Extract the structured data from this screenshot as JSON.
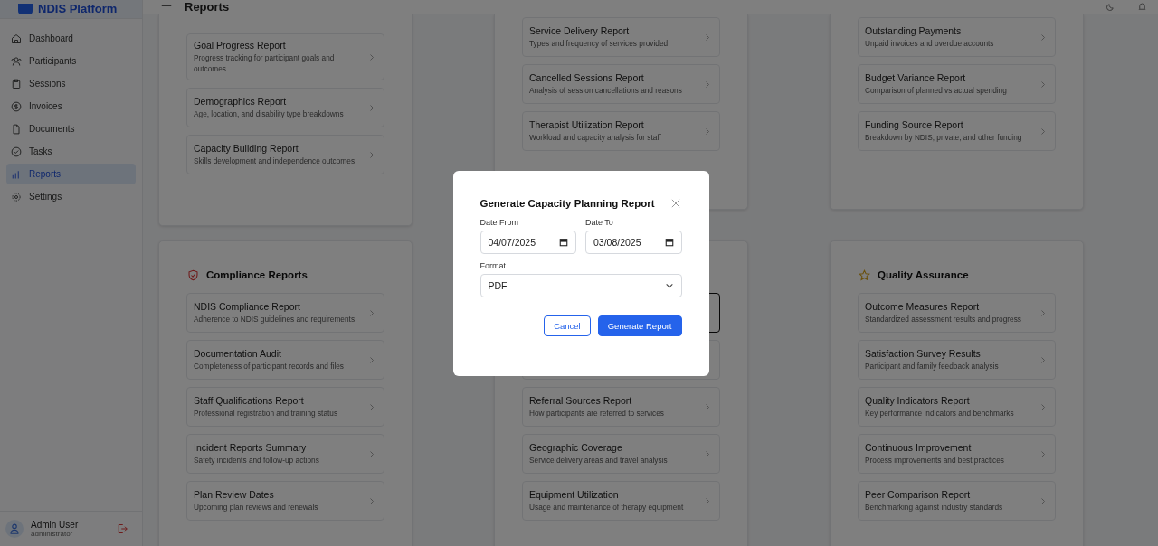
{
  "app": {
    "logo": "NDIS Platform",
    "page_title": "Reports"
  },
  "sidebar": {
    "items": [
      {
        "label": "Dashboard",
        "kind": "home",
        "selected": false
      },
      {
        "label": "Participants",
        "kind": "users",
        "selected": false
      },
      {
        "label": "Sessions",
        "kind": "clipboard",
        "selected": false
      },
      {
        "label": "Invoices",
        "kind": "dollar",
        "selected": false
      },
      {
        "label": "Documents",
        "kind": "file",
        "selected": false
      },
      {
        "label": "Tasks",
        "kind": "check",
        "selected": false
      },
      {
        "label": "Reports",
        "kind": "chart",
        "selected": true
      },
      {
        "label": "Settings",
        "kind": "gear",
        "selected": false
      }
    ],
    "user": {
      "name": "Admin User",
      "role": "administrator"
    }
  },
  "top_sections": [
    {
      "items": [
        {
          "title": "Goal Progress Report",
          "description": "Progress tracking for participant goals and outcomes",
          "selected": false
        },
        {
          "title": "Demographics Report",
          "description": "Age, location, and disability type breakdowns",
          "selected": false
        },
        {
          "title": "Capacity Building Report",
          "description": "Skills development and independence outcomes",
          "selected": false
        }
      ]
    },
    {
      "items": [
        {
          "title": "Service Delivery Report",
          "description": "Types and frequency of services provided",
          "selected": false
        },
        {
          "title": "Cancelled Sessions Report",
          "description": "Analysis of session cancellations and reasons",
          "selected": false
        },
        {
          "title": "Therapist Utilization Report",
          "description": "Workload and capacity analysis for staff",
          "selected": false
        }
      ]
    },
    {
      "items": [
        {
          "title": "Outstanding Payments",
          "description": "Unpaid invoices and overdue accounts",
          "selected": false
        },
        {
          "title": "Budget Variance Report",
          "description": "Comparison of planned vs actual spending",
          "selected": false
        },
        {
          "title": "Funding Source Report",
          "description": "Breakdown by NDIS, private, and other funding",
          "selected": false
        }
      ]
    }
  ],
  "bottom_sections": [
    {
      "title": "Compliance Reports",
      "kind": "shield",
      "items": [
        {
          "title": "NDIS Compliance Report",
          "description": "Adherence to NDIS guidelines and requirements",
          "selected": false
        },
        {
          "title": "Documentation Audit",
          "description": "Completeness of participant records and files",
          "selected": false
        },
        {
          "title": "Staff Qualifications Report",
          "description": "Professional registration and training status",
          "selected": false
        },
        {
          "title": "Incident Reports Summary",
          "description": "Safety incidents and follow-up actions",
          "selected": false
        },
        {
          "title": "Plan Review Dates",
          "description": "Upcoming plan reviews and renewals",
          "selected": false
        }
      ]
    },
    {
      "items": [
        {
          "selected": true
        },
        {
          "selected": false
        },
        {
          "title": "Referral Sources Report",
          "description": "How participants are referred to services",
          "selected": false
        },
        {
          "title": "Geographic Coverage",
          "description": "Service delivery areas and travel analysis",
          "selected": false
        },
        {
          "title": "Equipment Utilization",
          "description": "Usage and maintenance of therapy equipment",
          "selected": false
        }
      ]
    },
    {
      "title": "Quality Assurance",
      "kind": "star",
      "items": [
        {
          "title": "Outcome Measures Report",
          "description": "Standardized assessment results and progress",
          "selected": false
        },
        {
          "title": "Satisfaction Survey Results",
          "description": "Participant and family feedback analysis",
          "selected": false
        },
        {
          "title": "Quality Indicators Report",
          "description": "Key performance indicators and benchmarks",
          "selected": false
        },
        {
          "title": "Continuous Improvement",
          "description": "Process improvements and best practices",
          "selected": false
        },
        {
          "title": "Peer Comparison Report",
          "description": "Benchmarking against industry standards",
          "selected": false
        }
      ]
    }
  ],
  "modal": {
    "title": "Generate Capacity Planning Report",
    "date_from": {
      "label": "Date From",
      "value": "04/07/2025"
    },
    "date_to": {
      "label": "Date To",
      "value": "03/08/2025"
    },
    "format": {
      "label": "Format",
      "value": "PDF"
    },
    "buttons": [
      {
        "label": "Cancel",
        "kind": "secondary"
      },
      {
        "label": "Generate Report",
        "kind": "primary"
      }
    ]
  }
}
